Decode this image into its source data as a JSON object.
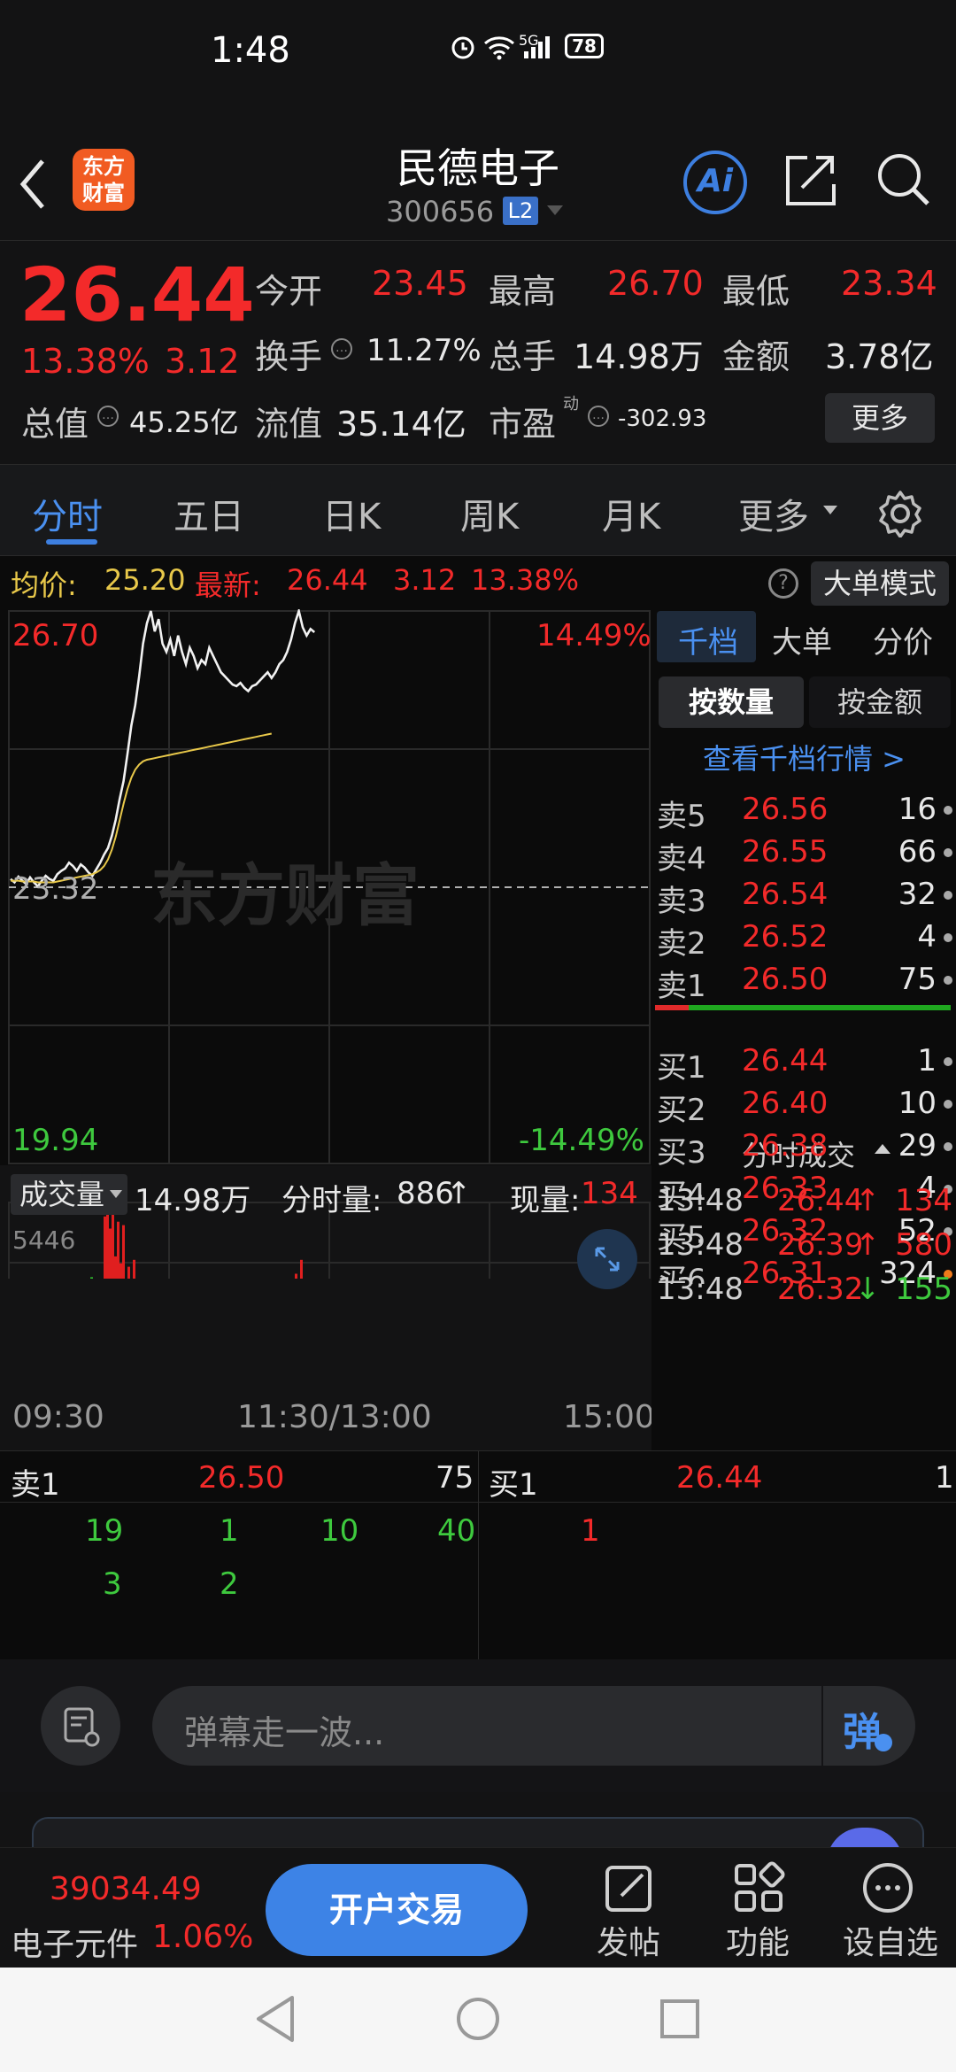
{
  "status": {
    "time": "1:48",
    "network": "5G",
    "battery": "78"
  },
  "header": {
    "back_icon": "back-arrow-icon",
    "logo_text_1": "东方",
    "logo_text_2": "财富",
    "title": "民德电子",
    "code": "300656",
    "level": "L2",
    "ai_label": "Ai"
  },
  "quote": {
    "price": "26.44",
    "change_pct": "13.38%",
    "change": "3.12",
    "open_label": "今开",
    "open": "23.45",
    "high_label": "最高",
    "high": "26.70",
    "low_label": "最低",
    "low": "23.34",
    "turnover_label": "换手",
    "turnover": "11.27%",
    "volume_label": "总手",
    "volume": "14.98万",
    "amount_label": "金额",
    "amount": "3.78亿",
    "mktcap_label": "总值",
    "mktcap": "45.25亿",
    "float_label": "流值",
    "float": "35.14亿",
    "pe_label": "市盈",
    "pe_sup": "动",
    "pe": "-302.93",
    "more": "更多"
  },
  "tabs": [
    "分时",
    "五日",
    "日K",
    "周K",
    "月K",
    "更多"
  ],
  "chart_info": {
    "avg_label": "均价:",
    "avg": "25.20",
    "latest_label": "最新:",
    "latest": "26.44",
    "chg": "3.12",
    "pct": "13.38%",
    "big_order_mode": "大单模式"
  },
  "chart_data": {
    "type": "line",
    "y_max": "26.70",
    "y_max_pct": "14.49%",
    "y_mid": "23.32",
    "y_min": "19.94",
    "y_min_pct": "-14.49%",
    "ylim": [
      19.94,
      26.7
    ],
    "x_ticks": [
      "09:30",
      "11:30/13:00",
      "15:00"
    ],
    "watermark": "东方财富",
    "series": [
      {
        "values": [
          23.42,
          23.38,
          23.45,
          23.4,
          23.36,
          23.44,
          23.38,
          23.33,
          23.4,
          23.46,
          23.42,
          23.4,
          23.48,
          23.52,
          23.55,
          23.62,
          23.58,
          23.52,
          23.6,
          23.56,
          23.5,
          23.46,
          23.54,
          23.62,
          23.72,
          23.8,
          23.95,
          24.15,
          24.4,
          24.62,
          24.95,
          25.3,
          25.55,
          25.9,
          26.3,
          26.55,
          26.7,
          26.45,
          26.6,
          26.3,
          26.2,
          26.35,
          26.15,
          26.4,
          26.2,
          26.05,
          26.25,
          26.15,
          26.0,
          26.1,
          26.05,
          26.25,
          26.15,
          26.05,
          25.95,
          25.9,
          25.85,
          25.8,
          25.78,
          25.82,
          25.76,
          25.72,
          25.78,
          25.8,
          25.85,
          25.9,
          25.95,
          25.88,
          25.95,
          26.05,
          26.1,
          26.2,
          26.35,
          26.55,
          26.7,
          26.5,
          26.4,
          26.48,
          26.44
        ]
      },
      {
        "values": [
          23.4,
          23.4,
          23.4,
          23.39,
          23.39,
          23.39,
          23.39,
          23.38,
          23.38,
          23.38,
          23.38,
          23.38,
          23.39,
          23.4,
          23.41,
          23.42,
          23.43,
          23.44,
          23.45,
          23.46,
          23.47,
          23.48,
          23.5,
          23.53,
          23.58,
          23.66,
          23.78,
          23.94,
          24.14,
          24.34,
          24.52,
          24.66,
          24.76,
          24.82,
          24.86,
          24.88,
          24.89,
          24.9,
          24.91,
          24.92,
          24.93,
          24.94,
          24.95,
          24.96,
          24.97,
          24.98,
          24.99,
          25.0,
          25.01,
          25.02,
          25.03,
          25.04,
          25.05,
          25.06,
          25.07,
          25.08,
          25.09,
          25.1,
          25.11,
          25.12,
          25.13,
          25.14,
          25.15,
          25.16,
          25.17,
          25.18,
          25.19,
          25.2
        ]
      }
    ]
  },
  "volume": {
    "label": "成交量",
    "total": "14.98万",
    "min_vol_label": "分时量:",
    "min_vol": "886",
    "cur_label": "现量:",
    "cur": "134",
    "max": "5446",
    "bars": [
      8,
      12,
      6,
      18,
      10,
      22,
      9,
      14,
      7,
      16,
      25,
      11,
      9,
      20,
      13,
      8,
      15,
      30,
      12,
      9,
      18,
      14,
      10,
      22,
      17,
      11,
      38,
      52,
      29,
      48,
      60,
      20,
      14,
      9,
      11,
      95,
      100,
      88,
      97,
      72,
      92,
      68,
      90,
      55,
      66,
      48,
      70,
      40,
      24,
      18,
      12,
      28,
      15,
      9,
      20,
      11,
      14,
      8,
      26,
      10,
      19,
      9,
      13,
      22,
      8,
      17,
      11,
      30,
      9,
      14,
      21,
      8,
      12,
      18,
      9,
      25,
      13,
      10,
      16,
      28,
      11,
      9,
      36,
      14,
      20,
      9,
      12,
      48,
      18,
      10,
      22,
      9,
      15,
      12,
      34,
      19,
      9,
      16,
      11,
      14,
      22,
      9,
      13,
      18,
      10,
      26,
      44,
      62,
      38,
      70,
      52,
      28,
      18,
      12,
      10,
      16
    ]
  },
  "orderbook": {
    "tabs": [
      "千档",
      "大单",
      "分价"
    ],
    "sub_tabs": [
      "按数量",
      "按金额"
    ],
    "link": "查看千档行情 >",
    "asks": [
      {
        "n": "卖5",
        "p": "26.56",
        "v": "16"
      },
      {
        "n": "卖4",
        "p": "26.55",
        "v": "66"
      },
      {
        "n": "卖3",
        "p": "26.54",
        "v": "32"
      },
      {
        "n": "卖2",
        "p": "26.52",
        "v": "4"
      },
      {
        "n": "卖1",
        "p": "26.50",
        "v": "75"
      }
    ],
    "bids": [
      {
        "n": "买1",
        "p": "26.44",
        "v": "1"
      },
      {
        "n": "买2",
        "p": "26.40",
        "v": "10"
      },
      {
        "n": "买3",
        "p": "26.38",
        "v": "29"
      },
      {
        "n": "买4",
        "p": "26.33",
        "v": "4"
      },
      {
        "n": "买5",
        "p": "26.32",
        "v": "52"
      },
      {
        "n": "买6",
        "p": "26.31",
        "v": "324"
      }
    ],
    "ticks_label": "分时成交",
    "ticks": [
      {
        "t": "13:48",
        "p": "26.44",
        "v": "134",
        "dir": "↑"
      },
      {
        "t": "13:48",
        "p": "26.39",
        "v": "580",
        "dir": "↑"
      },
      {
        "t": "13:48",
        "p": "26.32",
        "v": "155",
        "dir": "↓"
      }
    ]
  },
  "queue": {
    "sell_label": "卖1",
    "sell_price": "26.50",
    "sell_total": "75",
    "buy_label": "买1",
    "buy_price": "26.44",
    "buy_total": "1",
    "sell_orders": [
      "19",
      "1",
      "10",
      "40",
      "3",
      "2"
    ],
    "buy_orders": [
      "1"
    ]
  },
  "danmu": {
    "placeholder": "弹幕走一波...",
    "send": "弹"
  },
  "tabbar": {
    "index_value": "39034.49",
    "index_name": "电子元件",
    "index_pct": "1.06%",
    "trade": "开户交易",
    "post": "发帖",
    "function": "功能",
    "watchlist": "设自选"
  }
}
